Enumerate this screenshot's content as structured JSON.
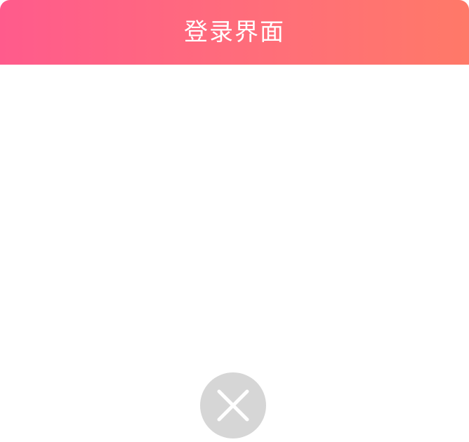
{
  "modal": {
    "title": "登录界面",
    "header_gradient": [
      "#ff5b8c",
      "#ff7968"
    ],
    "body_color": "#ffffff"
  },
  "close_button": {
    "icon": "close-icon",
    "background": "#d6d6d6",
    "icon_color": "#ffffff"
  }
}
